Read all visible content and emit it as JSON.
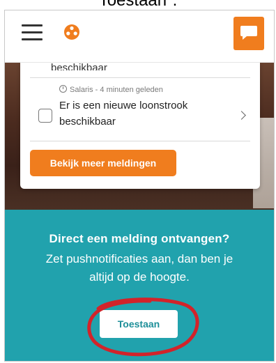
{
  "caption": "Toestaan\".",
  "header": {
    "menu_icon": "hamburger-menu-icon",
    "logo_icon": "brand-logo-icon",
    "chat_icon": "chat-bubble-icon",
    "accent": "#f07d1e"
  },
  "notifications": {
    "previous_item_text": "beschikbaar",
    "items": [
      {
        "meta": "Salaris - 4 minuten geleden",
        "text": "Er is een nieuwe loonstrook beschikbaar"
      }
    ],
    "more_button": "Bekijk meer meldingen"
  },
  "push_banner": {
    "title": "Direct een melding ontvangen?",
    "body": "Zet pushnotificaties aan, dan ben je altijd op de hoogte.",
    "allow_button": "Toestaan",
    "background": "#21a2ad",
    "annotation_color": "#d2232a"
  }
}
